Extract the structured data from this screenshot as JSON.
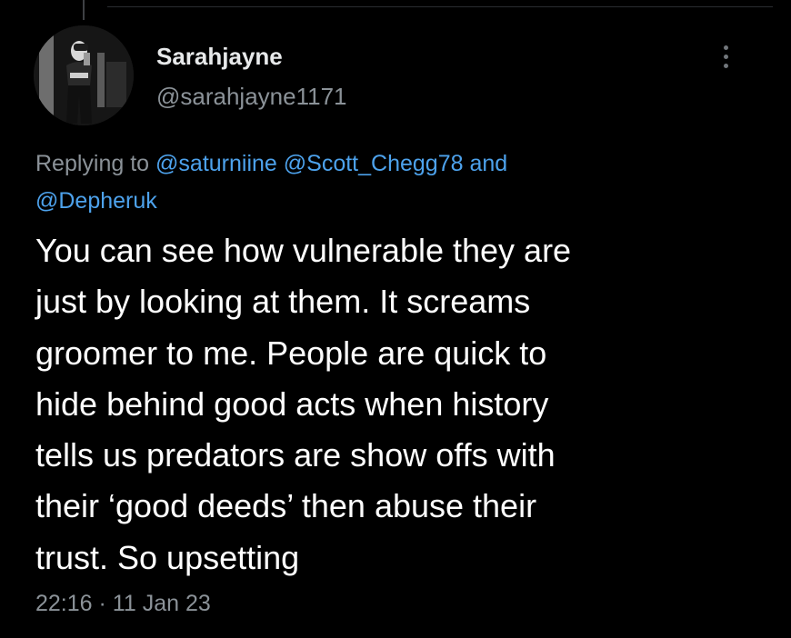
{
  "author": {
    "display_name": "Sarahjayne",
    "handle": "@sarahjayne1171"
  },
  "reply_context": {
    "prefix": "Replying to ",
    "mentions": [
      "@saturniine",
      "@Scott_Chegg78",
      "@Depheruk"
    ],
    "conjunction": "and"
  },
  "tweet": {
    "lines": [
      "You can see how vulnerable they are",
      "just by looking at them. It screams",
      "groomer to me. People are quick to",
      "hide behind good acts when history",
      "tells us predators are show offs with",
      "their ‘good deeds’ then abuse their",
      "trust. So upsetting"
    ]
  },
  "meta": {
    "time": "22:16",
    "separator": "·",
    "date": "11 Jan 23"
  },
  "icons": {
    "more": "more-options-icon",
    "avatar": "profile-photo"
  },
  "colors": {
    "background": "#000000",
    "text": "#ffffff",
    "secondary": "#8b9298",
    "link": "#4da2ec"
  }
}
